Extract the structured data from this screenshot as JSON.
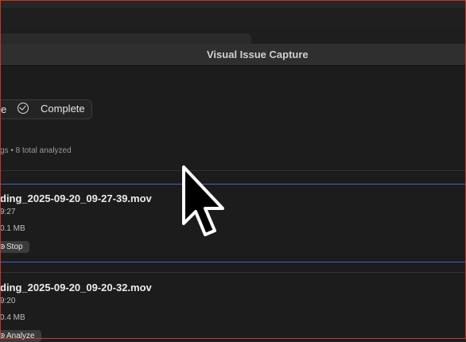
{
  "window": {
    "title": "Visual Issue Capture"
  },
  "status_bar": {
    "left_fragment": "e",
    "complete_label": "Complete"
  },
  "summary": "gs • 8 total analyzed",
  "items": [
    {
      "name": "ding_2025-09-20_09-27-39.mov",
      "time": "9:27",
      "size": "0.1 MB",
      "action": "Stop"
    },
    {
      "name": "ding_2025-09-20_09-20-32.mov",
      "time": "9:20",
      "size": "0.4 MB",
      "action": "Analyze"
    }
  ],
  "colors": {
    "accent_line": "#3b64c6",
    "frame_border": "#c0392b"
  }
}
